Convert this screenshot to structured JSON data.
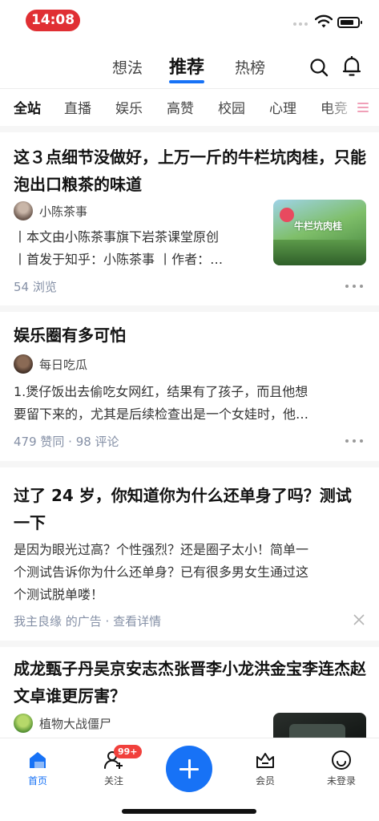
{
  "status_bar": {
    "time": "14:08"
  },
  "top_tabs": [
    {
      "label": "想法"
    },
    {
      "label": "推荐",
      "active": true
    },
    {
      "label": "热榜"
    }
  ],
  "categories": [
    "全站",
    "直播",
    "娱乐",
    "高赞",
    "校园",
    "心理",
    "电竞"
  ],
  "feed": [
    {
      "title": "这３点细节没做好，上万一斤的牛栏坑肉桂，只能泡出口粮茶的味道",
      "author": "小陈茶事",
      "excerpt_lines": [
        "丨本文由小陈茶事旗下岩茶课堂原创",
        "丨首发于知乎：小陈茶事 丨作者：…"
      ],
      "meta": "54 浏览",
      "thumbnail_text": "牛栏坑肉桂"
    },
    {
      "title": "娱乐圈有多可怕",
      "author": "每日吃瓜",
      "excerpt_lines": [
        "1.煲仔饭出去偷吃女网红，结果有了孩子，而且他想",
        "要留下来的，尤其是后续检查出是一个女娃时，他…"
      ],
      "meta": "479 赞同 · 98 评论"
    },
    {
      "title": "过了 24 岁，你知道你为什么还单身了吗？测试一下",
      "excerpt_lines": [
        "是因为眼光过高？个性强烈？还是圈子太小！简单一",
        "个测试告诉你为什么还单身？已有很多男女生通过这",
        "个测试脱单喽！"
      ],
      "meta": "我主良缘 的广告 · 查看详情"
    },
    {
      "title": "成龙甄子丹吴京安志杰张晋李小龙洪金宝李连杰赵文卓谁更厉害？",
      "author": "植物大战僵尸"
    }
  ],
  "bottom_nav": [
    {
      "label": "首页",
      "icon": "home-icon",
      "active": true
    },
    {
      "label": "关注",
      "icon": "follow-icon",
      "badge": "99+"
    },
    {
      "label": "会员",
      "icon": "vip-icon"
    },
    {
      "label": "未登录",
      "icon": "profile-icon"
    }
  ],
  "colors": {
    "accent": "#1772f6",
    "badge": "#f1403c",
    "time_pill": "#e02f33"
  }
}
